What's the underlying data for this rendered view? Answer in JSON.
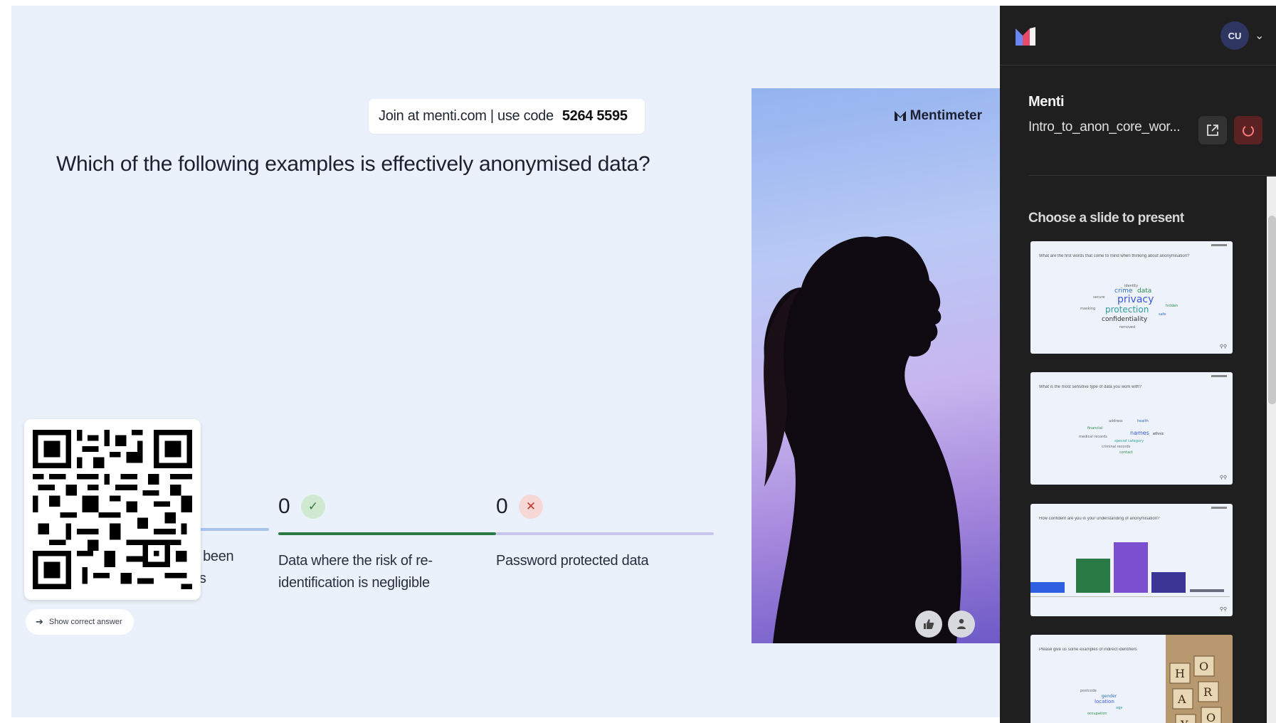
{
  "slide": {
    "join_prefix": "Join at menti.com | use code",
    "join_code": "5264 5595",
    "question": "Which of the following examples is effectively anonymised data?",
    "options": [
      {
        "count": "0",
        "label": "Data where personal identifiers have been removed from the datasets",
        "label_visible": "e been\nns"
      },
      {
        "count": "0",
        "label": "Data where the risk of re-identification is negligible",
        "correct": true
      },
      {
        "count": "0",
        "label": "Password protected data",
        "correct": false
      }
    ],
    "show_answer_label": "Show correct answer",
    "brand": "Mentimeter"
  },
  "panel": {
    "avatar_initials": "CU",
    "presentation_title": "Menti",
    "presentation_file": "Intro_to_anon_core_wor...",
    "choose_label": "Choose a slide to present",
    "thumbnails": [
      {
        "question": "What are the first words that come to mind when thinking about anonymisation?",
        "type": "wordcloud"
      },
      {
        "question": "What is the most sensitive type of data you work with?",
        "type": "wordcloud"
      },
      {
        "question": "How confident are you in your understanding of anonymisation?",
        "type": "bar"
      },
      {
        "question": "Please give us some examples of indirect identifiers",
        "type": "wordcloud"
      }
    ]
  },
  "colors": {
    "slide_bg": "#eaf1fa",
    "panel_bg": "#1f1f1f",
    "correct_bar": "#2a7a46",
    "neutral_bar": "#a8c4ee",
    "lavender_bar": "#c9c6ee"
  }
}
